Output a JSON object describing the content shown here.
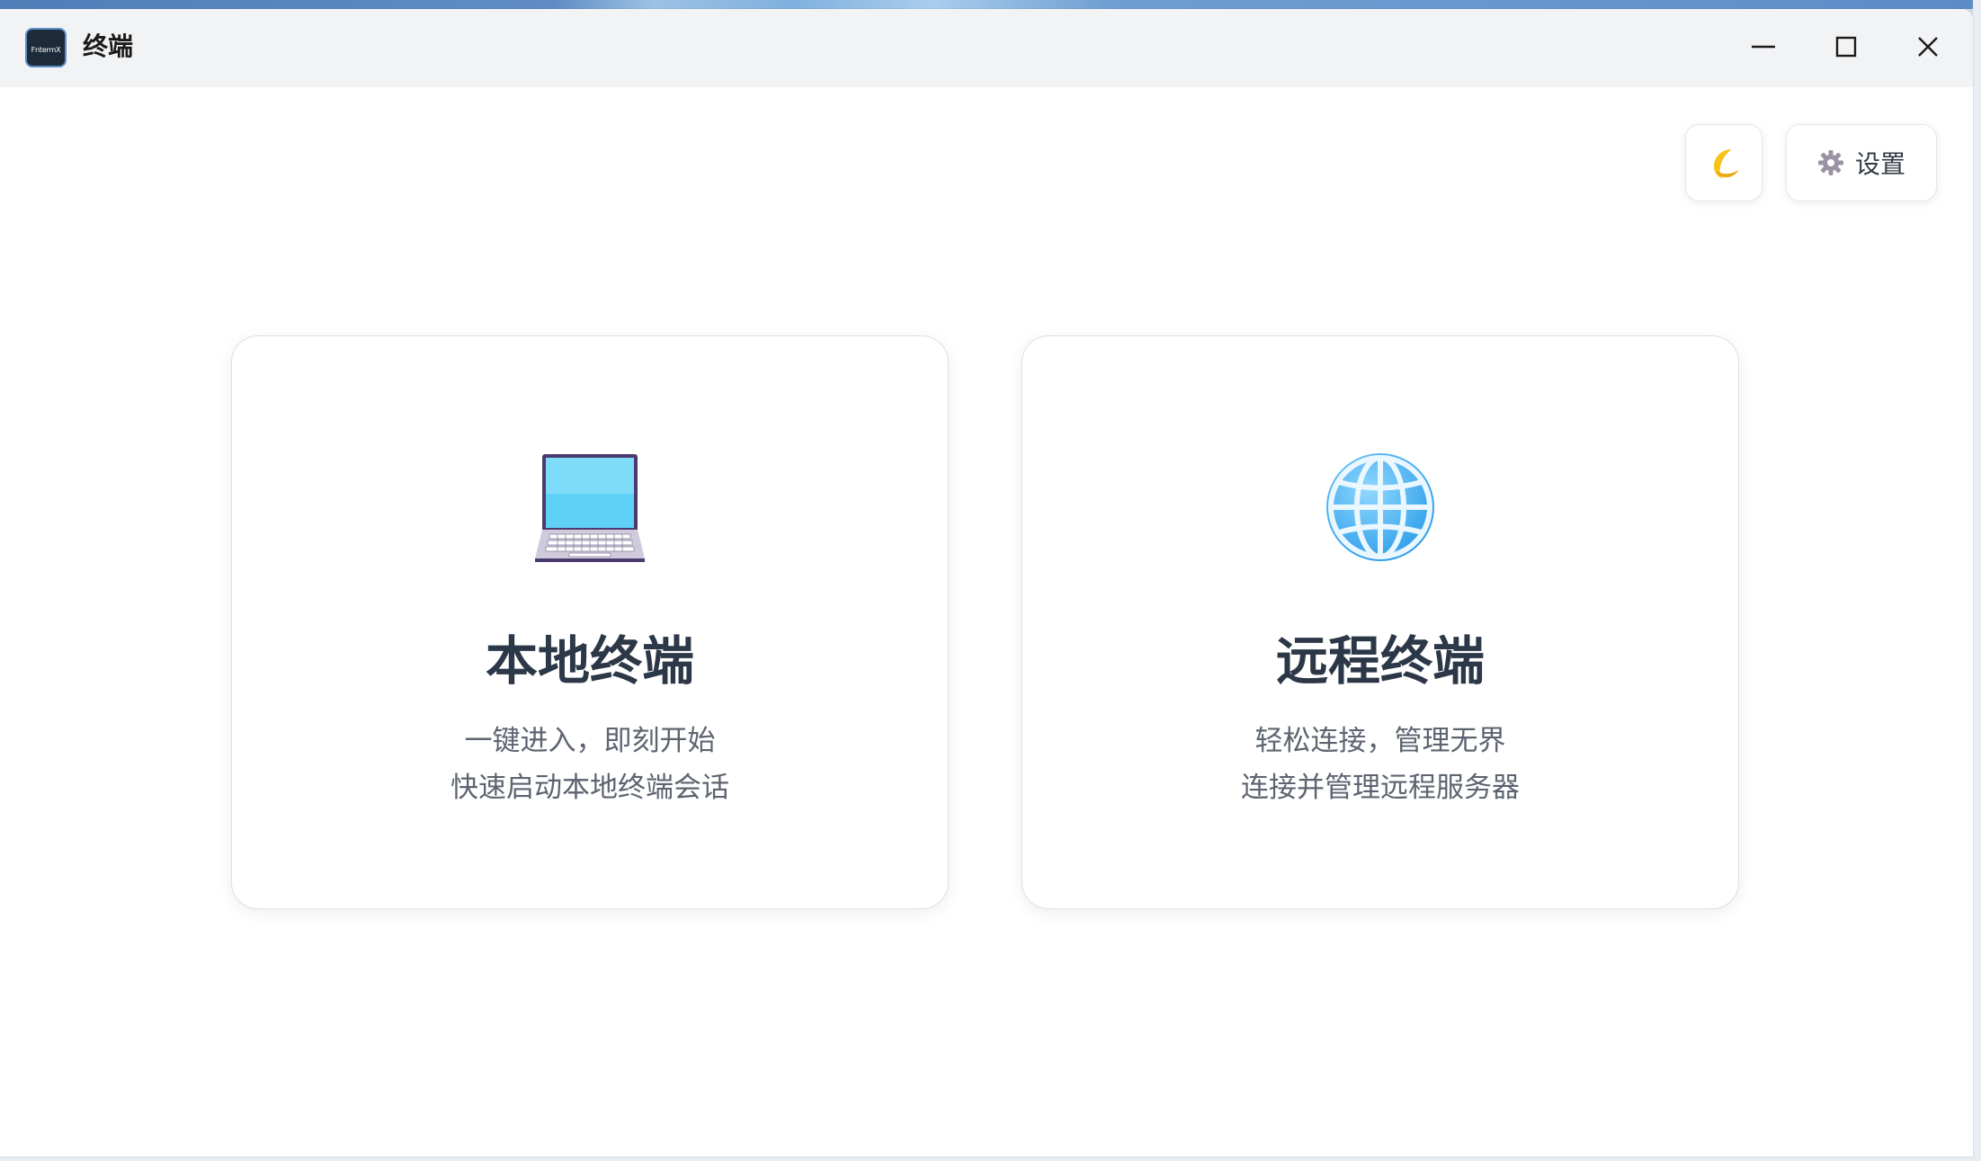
{
  "window": {
    "title": "终端",
    "app_icon_text": "FntermX",
    "controls": {
      "minimize": "minimize-icon",
      "maximize": "maximize-icon",
      "close": "close-icon"
    }
  },
  "toolbar": {
    "theme_toggle_icon": "moon-icon",
    "settings_icon": "gear-icon",
    "settings_label": "设置"
  },
  "cards": [
    {
      "icon": "laptop-icon",
      "title": "本地终端",
      "line1": "一键进入，即刻开始",
      "line2": "快速启动本地终端会话"
    },
    {
      "icon": "globe-icon",
      "title": "远程终端",
      "line1": "轻松连接，管理无界",
      "line2": "连接并管理远程服务器"
    }
  ],
  "colors": {
    "titlebar_bg": "#f2f3f5",
    "card_title": "#2c3848",
    "card_text": "#5d6470",
    "globe_blue": "#3aa6ee",
    "laptop_screen": "#5fd0f5",
    "moon_yellow": "#f7c21c"
  }
}
